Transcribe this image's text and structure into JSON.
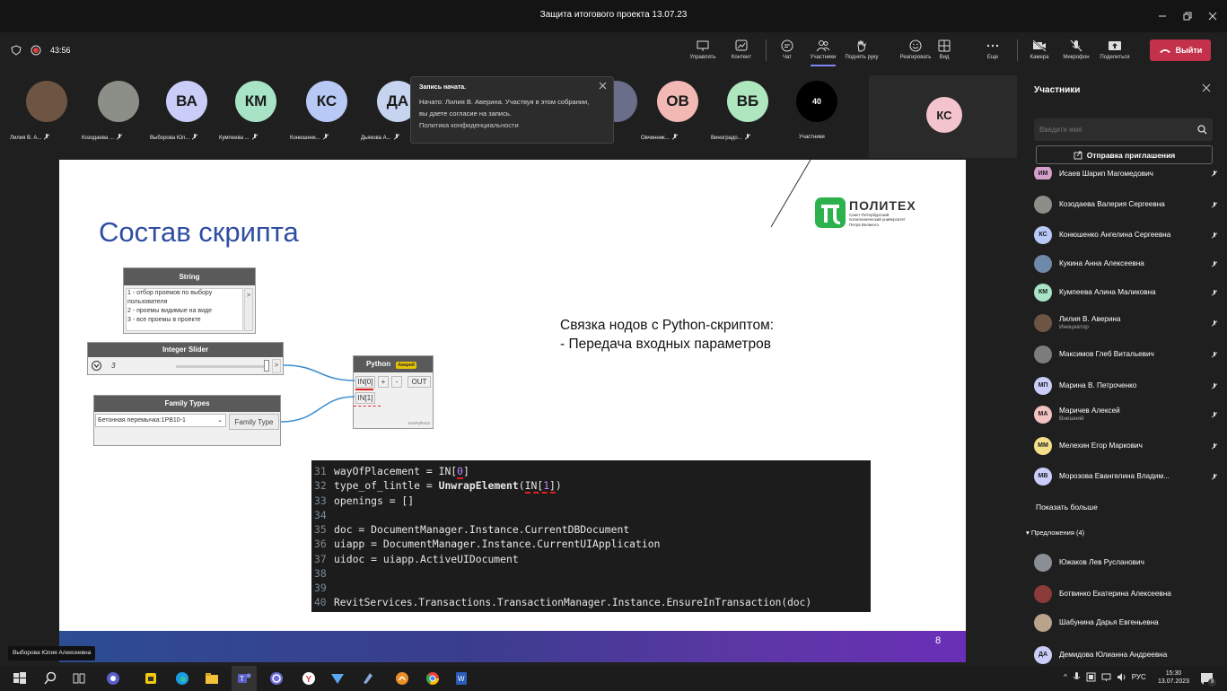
{
  "window": {
    "title": "Защита итогового проекта 13.07.23"
  },
  "meeting": {
    "timer": "43:56",
    "toolbar": [
      {
        "key": "manage",
        "label": "Управлять"
      },
      {
        "key": "content",
        "label": "Контент"
      },
      {
        "key": "chat",
        "label": "Чат"
      },
      {
        "key": "people",
        "label": "Участники"
      },
      {
        "key": "raise",
        "label": "Поднять руку"
      },
      {
        "key": "react",
        "label": "Реагировать"
      },
      {
        "key": "view",
        "label": "Вид"
      },
      {
        "key": "more",
        "label": "Еще"
      },
      {
        "key": "camera",
        "label": "Камера"
      },
      {
        "key": "mic",
        "label": "Микрофон"
      },
      {
        "key": "share",
        "label": "Поделиться"
      }
    ],
    "leave_label": "Выйти"
  },
  "strip": {
    "participants": [
      {
        "name": "Лилия В. А...",
        "initials": "",
        "color": "#6d5443"
      },
      {
        "name": "Козодаева ...",
        "initials": "",
        "color": "#8c8f88"
      },
      {
        "name": "Выборова Юл...",
        "initials": "ВА",
        "color": "#c9cdf7"
      },
      {
        "name": "Кумпеева ...",
        "initials": "КМ",
        "color": "#a8e3c6"
      },
      {
        "name": "Конюшенк...",
        "initials": "КС",
        "color": "#b8c9f5"
      },
      {
        "name": "Дьякова А...",
        "initials": "ДА",
        "color": "#c7d4ef"
      },
      {
        "name": "...д...",
        "initials": "",
        "color": "#6b6e8a"
      },
      {
        "name": "Овчинник...",
        "initials": "ОВ",
        "color": "#f2b8b4"
      },
      {
        "name": "Виноградо...",
        "initials": "ВБ",
        "color": "#aee6be"
      }
    ],
    "count": "40",
    "count_label": "Участники",
    "spotlight_initials": "КС"
  },
  "toast": {
    "title": "Запись начата.",
    "body": "Начато: Лилия В. Аверина. Участвуя в этом собрании, вы даете согласие на запись.",
    "link": "Политика конфиденциальности"
  },
  "slide": {
    "title": "Состав скрипта",
    "logo_name": "ПОЛИТЕХ",
    "logo_sub1": "Санкт-Петербургский",
    "logo_sub2": "политехнический университет",
    "logo_sub3": "Петра Великого",
    "caption_line1": "Связка нодов с Python-скриптом:",
    "caption_line2": "- Передача входных параметров",
    "page_number": "8",
    "string_node": {
      "title": "String",
      "lines": [
        "1 - отбор проемов по выбору",
        "пользователя",
        "2 - проемы видимые на виде",
        "3 - все проемы в проекте"
      ]
    },
    "slider_node": {
      "title": "Integer Slider",
      "value": "3"
    },
    "family_node": {
      "title": "Family Types",
      "value": "Бетонная перемычка:1РВ10-1",
      "out": "Family Type"
    },
    "python_node": {
      "title": "Python",
      "badge": "Аварий",
      "in0": "IN[0]",
      "in1": "IN[1]",
      "out": "OUT",
      "plus": "+",
      "minus": "-",
      "footer": "IronPython2"
    },
    "code": [
      {
        "n": "31",
        "t": "wayOfPlacement = IN[0]"
      },
      {
        "n": "32",
        "t": "type_of_lintle = UnwrapElement(IN[1])"
      },
      {
        "n": "33",
        "t": "openings = []"
      },
      {
        "n": "34",
        "t": ""
      },
      {
        "n": "35",
        "t": "doc = DocumentManager.Instance.CurrentDBDocument"
      },
      {
        "n": "36",
        "t": "uiapp = DocumentManager.Instance.CurrentUIApplication"
      },
      {
        "n": "37",
        "t": "uidoc = uiapp.ActiveUIDocument"
      },
      {
        "n": "38",
        "t": ""
      },
      {
        "n": "39",
        "t": ""
      },
      {
        "n": "40",
        "t": "RevitServices.Transactions.TransactionManager.Instance.EnsureInTransaction(doc)"
      }
    ]
  },
  "presenter_label": "Выборова Юлия Алексеевна",
  "panel": {
    "title": "Участники",
    "search_placeholder": "Введите имя",
    "invite_label": "Отправка приглашения",
    "members": [
      {
        "name": "Исаев Шарип Магомедович",
        "initials": "ИМ",
        "color": "#d6a0cc",
        "sub": ""
      },
      {
        "name": "Козодаева Валерия Сергеевна",
        "initials": "",
        "color": "#8c8f88",
        "sub": ""
      },
      {
        "name": "Конюшенко Ангелина Сергеевна",
        "initials": "КС",
        "color": "#b8c9f5",
        "sub": ""
      },
      {
        "name": "Кукина Анна Алексеевна",
        "initials": "",
        "color": "#6f8aa8",
        "sub": ""
      },
      {
        "name": "Кумпеева Алина Маликовна",
        "initials": "КМ",
        "color": "#a8e3c6",
        "sub": ""
      },
      {
        "name": "Лилия В. Аверина",
        "initials": "",
        "color": "#6d5443",
        "sub": "Инициатор"
      },
      {
        "name": "Максимов Глеб Витальевич",
        "initials": "",
        "color": "#7c7c7c",
        "sub": ""
      },
      {
        "name": "Марина В. Петроченко",
        "initials": "МП",
        "color": "#c9cdf7",
        "sub": ""
      },
      {
        "name": "Маричев Алексей",
        "initials": "МА",
        "color": "#f2c2c0",
        "sub": "Внешний"
      },
      {
        "name": "Мелехин Егор Маркович",
        "initials": "ММ",
        "color": "#f5e08a",
        "sub": ""
      },
      {
        "name": "Морозова Евангелина Владим...",
        "initials": "МВ",
        "color": "#c9cdf7",
        "sub": ""
      }
    ],
    "show_more": "Показать больше",
    "suggestions_label": "Предложения (4)",
    "suggestions": [
      {
        "name": "Южаков Лев Русланович",
        "color": "#8a8f96"
      },
      {
        "name": "Ботвинко Екатерина Алексеевна",
        "color": "#8b3a3a"
      },
      {
        "name": "Шабунина Дарья Евгеньевна",
        "color": "#b8a48a"
      },
      {
        "name": "Демидова Юлианна Андреевна",
        "initials": "ДА",
        "color": "#c9cdf7"
      }
    ]
  },
  "taskbar": {
    "lang": "РУС",
    "time": "15:30",
    "date": "13.07.2023",
    "notif": "9"
  },
  "colors": {
    "slide_title": "#2f4ea2",
    "leave": "#c4314b",
    "logo_green": "#2bb24c",
    "python_badge": "#e8c200",
    "underline_red": "#e02020"
  }
}
